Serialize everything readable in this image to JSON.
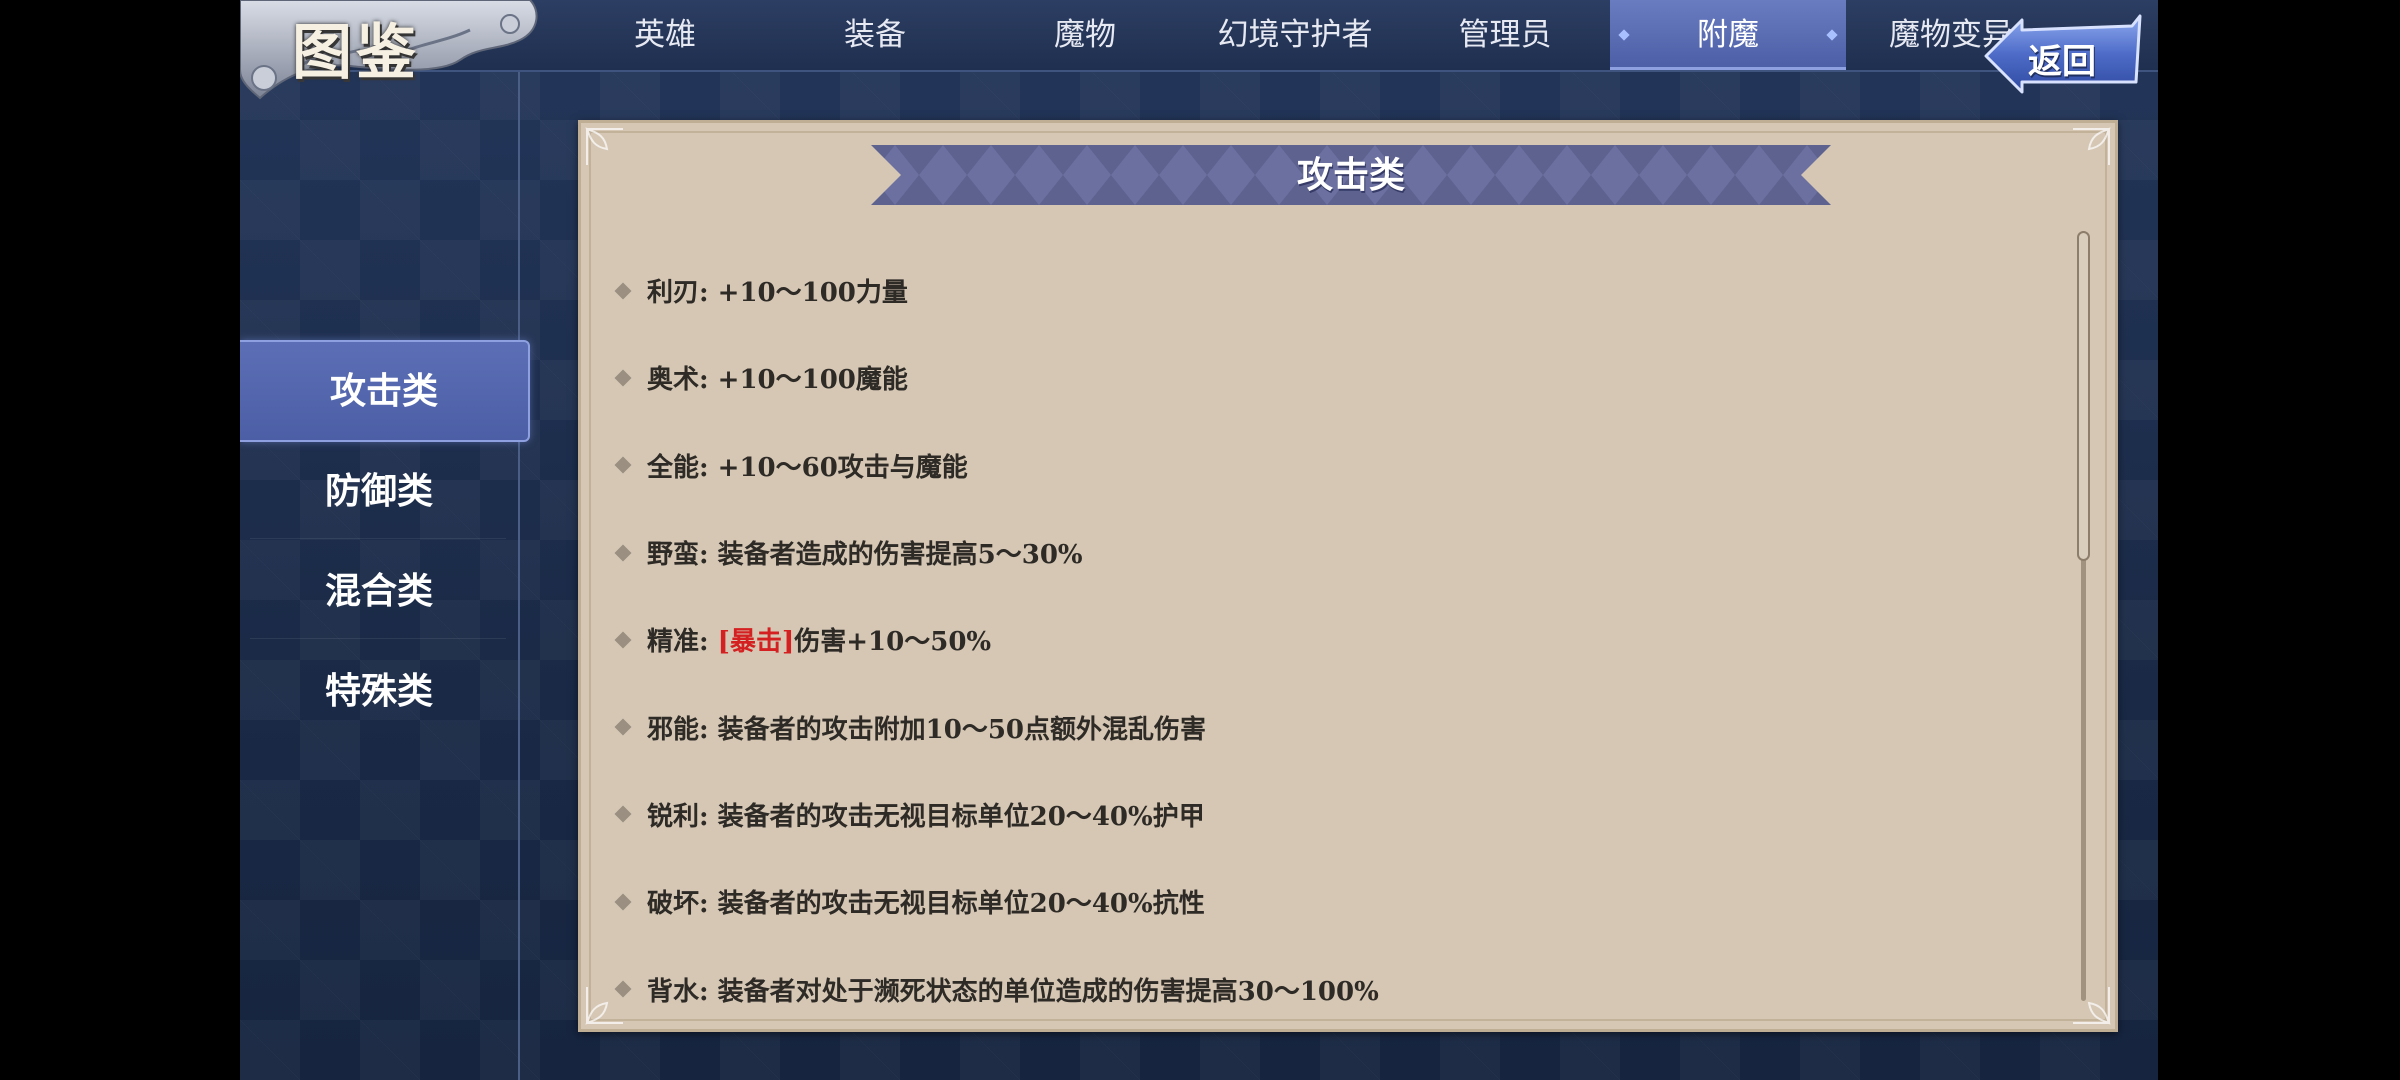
{
  "header": {
    "title": "图鉴",
    "back_label": "返回"
  },
  "tabs": [
    {
      "label": "英雄",
      "active": false
    },
    {
      "label": "装备",
      "active": false
    },
    {
      "label": "魔物",
      "active": false
    },
    {
      "label": "幻境守护者",
      "active": false
    },
    {
      "label": "管理员",
      "active": false
    },
    {
      "label": "附魔",
      "active": true
    },
    {
      "label": "魔物变异",
      "active": false
    }
  ],
  "sidebar": {
    "items": [
      {
        "label": "攻击类",
        "active": true
      },
      {
        "label": "防御类",
        "active": false
      },
      {
        "label": "混合类",
        "active": false
      },
      {
        "label": "特殊类",
        "active": false
      }
    ]
  },
  "panel": {
    "title": "攻击类",
    "entries": [
      {
        "name": "利刃: ",
        "desc": "+10～100力量"
      },
      {
        "name": "奥术: ",
        "desc": "+10～100魔能"
      },
      {
        "name": "全能: ",
        "desc": "+10～60攻击与魔能"
      },
      {
        "name": "野蛮: ",
        "desc": "装备者造成的伤害提高5～30%"
      },
      {
        "name": "精准: ",
        "highlight": "[暴击]",
        "desc": "伤害+10～50%"
      },
      {
        "name": "邪能: ",
        "desc": "装备者的攻击附加10～50点额外混乱伤害"
      },
      {
        "name": "锐利: ",
        "desc": "装备者的攻击无视目标单位20～40%护甲"
      },
      {
        "name": "破坏: ",
        "desc": "装备者的攻击无视目标单位20～40%抗性"
      },
      {
        "name": "背水: ",
        "desc": "装备者对处于濒死状态的单位造成的伤害提高30～100%"
      }
    ],
    "scroll_position": 0.0
  },
  "colors": {
    "background": "#1d2d4c",
    "active_tab": "#4b5ea6",
    "panel": "#d5c7b4",
    "banner": "#5d628f",
    "highlight": "#d42020"
  },
  "icons": {
    "bullet": "diamond-bullet-icon",
    "back": "back-arrow-icon"
  }
}
